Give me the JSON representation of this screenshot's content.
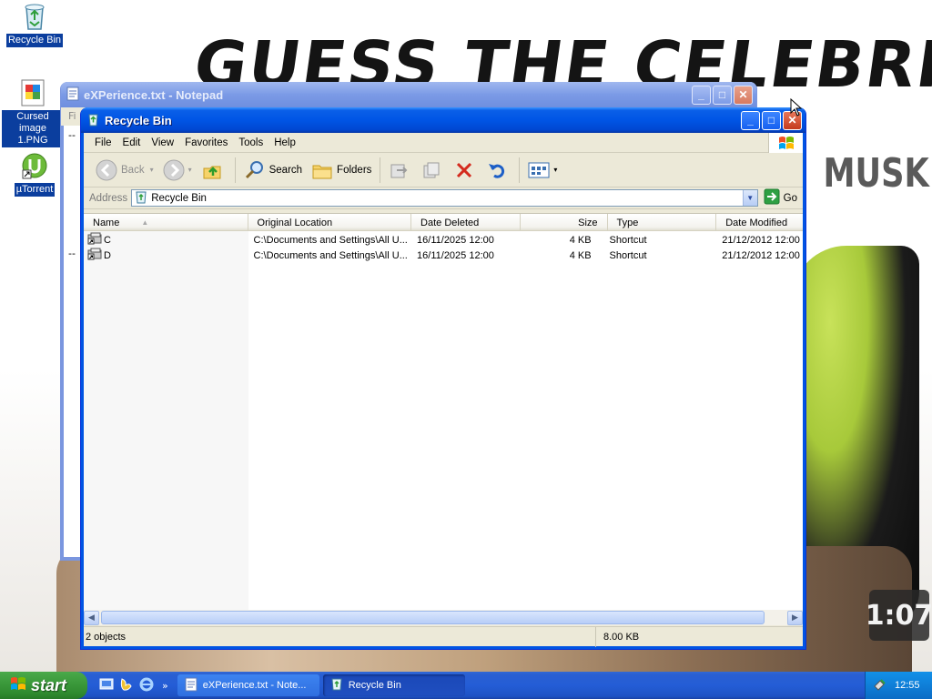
{
  "wallpaper": {
    "title": "GUESS THE CELEBRITY",
    "subtitle": "MUSK",
    "timer": "1:07"
  },
  "desktop_icons": [
    {
      "label": "Recycle Bin",
      "icon": "recycle-bin-icon"
    },
    {
      "label": "Cursed image 1.PNG",
      "icon": "image-file-icon"
    },
    {
      "label": "µTorrent",
      "icon": "utorrent-icon"
    }
  ],
  "notepad": {
    "title": "eXPerience.txt - Notepad",
    "menu_first": "Fi",
    "line_dash": "--"
  },
  "explorer": {
    "title": "Recycle Bin",
    "menu": [
      "File",
      "Edit",
      "View",
      "Favorites",
      "Tools",
      "Help"
    ],
    "toolbar": {
      "back": "Back",
      "search": "Search",
      "folders": "Folders"
    },
    "address": {
      "label": "Address",
      "value": "Recycle Bin",
      "go": "Go"
    },
    "columns": [
      "Name",
      "Original Location",
      "Date Deleted",
      "Size",
      "Type",
      "Date Modified"
    ],
    "rows": [
      {
        "name": "C",
        "location": "C:\\Documents and Settings\\All U...",
        "deleted": "16/11/2025 12:00",
        "size": "4 KB",
        "type": "Shortcut",
        "modified": "21/12/2012 12:00"
      },
      {
        "name": "D",
        "location": "C:\\Documents and Settings\\All U...",
        "deleted": "16/11/2025 12:00",
        "size": "4 KB",
        "type": "Shortcut",
        "modified": "21/12/2012 12:00"
      }
    ],
    "status": {
      "objects": "2 objects",
      "size": "8.00 KB"
    }
  },
  "taskbar": {
    "start": "start",
    "quick_more": "»",
    "tasks": [
      {
        "label": "eXPerience.txt - Note...",
        "active": false
      },
      {
        "label": "Recycle Bin",
        "active": true
      }
    ],
    "clock": "12:55"
  },
  "colors": {
    "xp_blue": "#0054e3",
    "start_green": "#3c9a3c",
    "tray_blue": "#0f7fd8",
    "delete_red": "#d42b1e"
  }
}
